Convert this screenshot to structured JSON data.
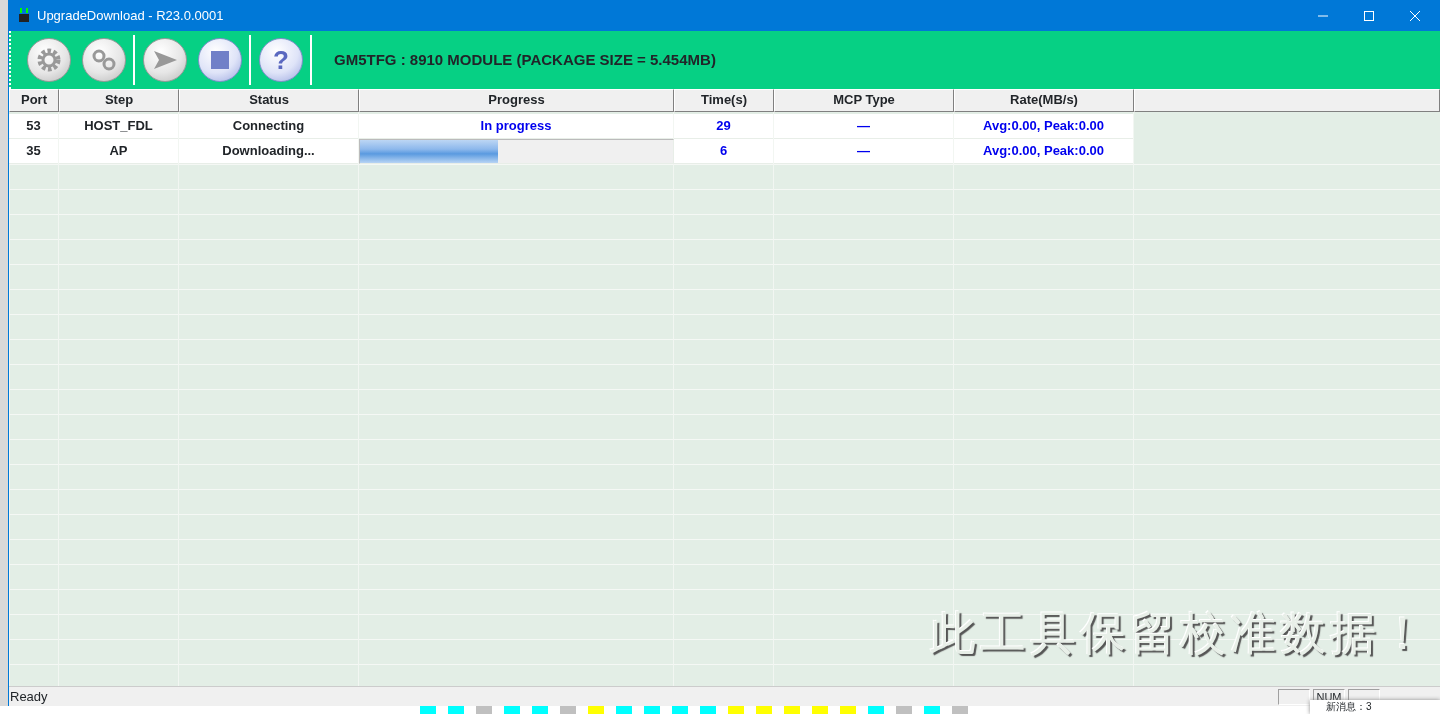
{
  "window": {
    "title": "UpgradeDownload - R23.0.0001"
  },
  "toolbar": {
    "buttons": [
      {
        "kind": "settings"
      },
      {
        "kind": "gears",
        "separator_after": true
      },
      {
        "kind": "start"
      },
      {
        "kind": "stop",
        "separator_after": true
      },
      {
        "kind": "help",
        "glyph": "?",
        "separator_after": true
      }
    ],
    "package_info": "GM5TFG : 8910 MODULE (PACKAGE SIZE = 5.454MB)"
  },
  "table": {
    "columns": [
      "Port",
      "Step",
      "Status",
      "Progress",
      "Time(s)",
      "MCP Type",
      "Rate(MB/s)"
    ],
    "rows": [
      {
        "port": "53",
        "step": "HOST_FDL",
        "status": "Connecting",
        "progress": {
          "kind": "text",
          "text": "In progress"
        },
        "time": "29",
        "mcp_type": "—",
        "rate": "Avg:0.00, Peak:0.00"
      },
      {
        "port": "35",
        "step": "AP",
        "status": "Downloading...",
        "progress": {
          "kind": "bar",
          "level": 0.44
        },
        "time": "6",
        "mcp_type": "—",
        "rate": "Avg:0.00, Peak:0.00"
      }
    ]
  },
  "notice": "此工具保留校准数据！",
  "status_bar": {
    "message": "Ready",
    "num_indicator": "NUM"
  },
  "notification": "新消息：3"
}
